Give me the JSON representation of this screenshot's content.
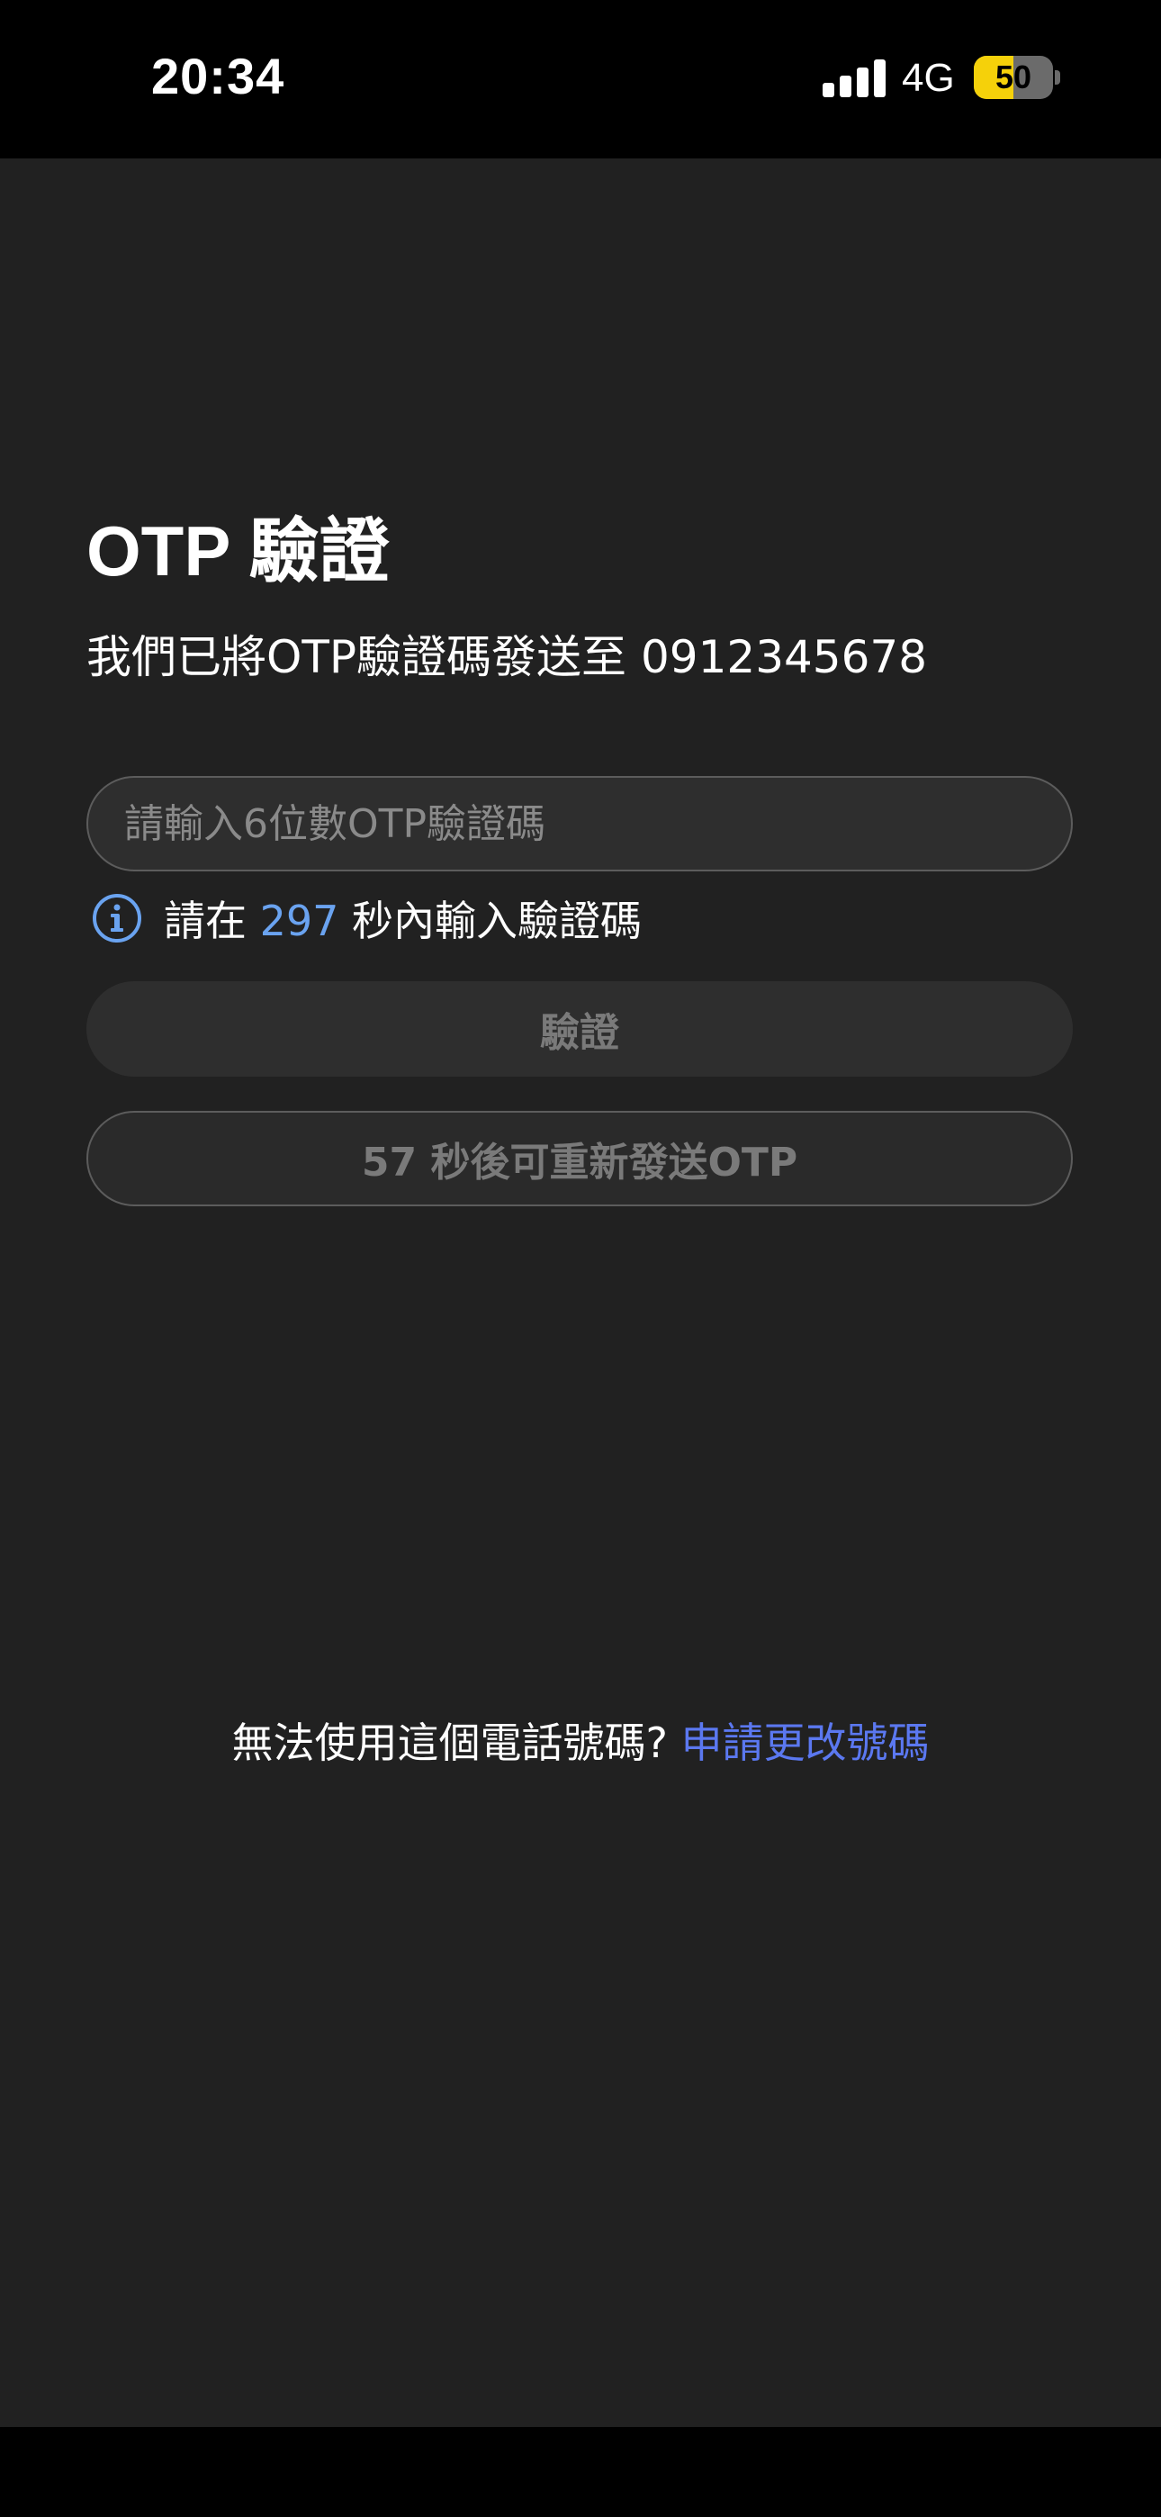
{
  "status_bar": {
    "time": "20:34",
    "network": "4G",
    "battery_percent": 50,
    "battery_label": "50",
    "icons": [
      "signal-icon",
      "battery-icon"
    ],
    "colors": {
      "battery_fill": "#f5d10a"
    }
  },
  "otp": {
    "title": "OTP 驗證",
    "sent_notice": "我們已將OTP驗證碼發送至 0912345678",
    "input_placeholder": "請輸入6位數OTP驗證碼",
    "input_value": "",
    "timer_prefix": "請在 ",
    "timer_seconds": "297",
    "timer_suffix": " 秒內輸入驗證碼",
    "timer_icon": "info-icon",
    "verify_label": "驗證",
    "resend_label": "57 秒後可重新發送OTP"
  },
  "footer": {
    "change_prompt": "無法使用這個電話號碼? ",
    "change_link": "申請更改號碼"
  },
  "colors": {
    "background": "#212121",
    "accent_timer": "#6aa3f0",
    "link": "#5b78f0"
  }
}
